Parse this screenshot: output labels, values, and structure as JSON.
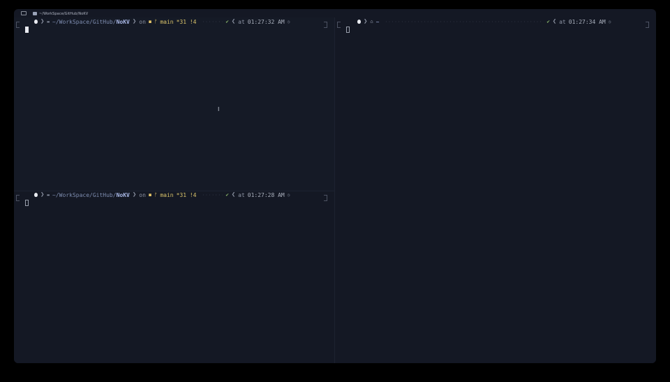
{
  "window": {
    "tab_title": "~/WorkSpace/GitHub/NoKV"
  },
  "panes": {
    "top_left": {
      "path_prefix": "~/WorkSpace/GitHub/",
      "path_current": "NoKV",
      "on_label": "on",
      "branch": "main",
      "git_status": "*31 !4",
      "at_label": "at",
      "time": "01:27:32 AM"
    },
    "bottom_left": {
      "path_prefix": "~/WorkSpace/GitHub/",
      "path_current": "NoKV",
      "on_label": "on",
      "branch": "main",
      "git_status": "*31 !4",
      "at_label": "at",
      "time": "01:27:28 AM"
    },
    "right": {
      "path": "~",
      "at_label": "at",
      "time": "01:27:34 AM"
    }
  },
  "icons": {
    "os": "apple-icon",
    "folder": "folder-icon",
    "home": "home-icon",
    "git": "git-icon",
    "branch": "branch-icon",
    "status_ok": "check-icon",
    "clock": "clock-icon"
  },
  "colors": {
    "background": "#141824",
    "path": "#a9b8e6",
    "branch": "#d9c36a",
    "ok": "#8bb86b"
  }
}
